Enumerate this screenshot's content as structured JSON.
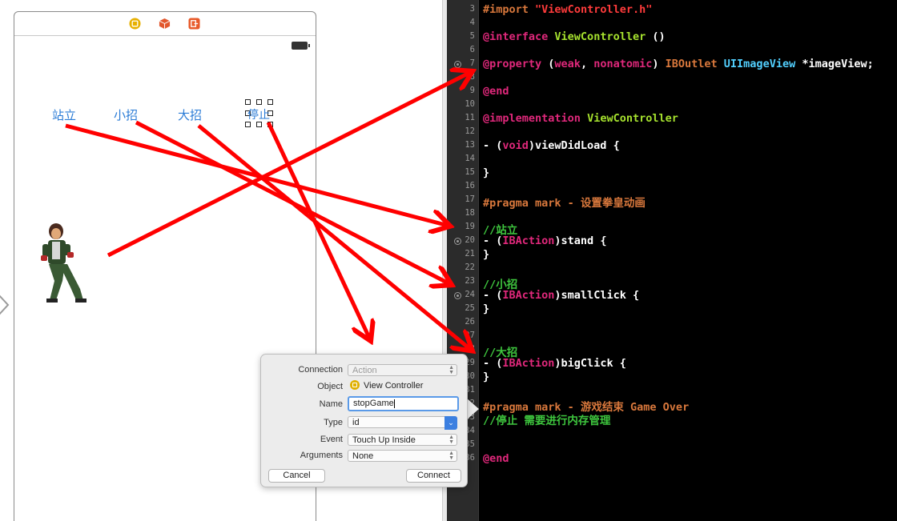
{
  "storyboard": {
    "buttons": [
      "站立",
      "小招",
      "大招",
      "停止"
    ],
    "toolbar_icons": [
      "view-controller-icon",
      "first-responder-icon",
      "exit-icon"
    ],
    "colors": {
      "button_text": "#2a7bd6",
      "arrow": "#ff0000"
    }
  },
  "code": {
    "lines": [
      {
        "n": "3",
        "t": "#import \"ViewController.h\""
      },
      {
        "n": "4",
        "t": ""
      },
      {
        "n": "5",
        "t": "@interface ViewController ()"
      },
      {
        "n": "6",
        "t": ""
      },
      {
        "n": "7",
        "t": "@property (weak, nonatomic) IBOutlet UIImageView *imageView;",
        "connected": true
      },
      {
        "n": "8",
        "t": ""
      },
      {
        "n": "9",
        "t": "@end"
      },
      {
        "n": "10",
        "t": ""
      },
      {
        "n": "11",
        "t": "@implementation ViewController"
      },
      {
        "n": "12",
        "t": ""
      },
      {
        "n": "13",
        "t": "- (void)viewDidLoad {"
      },
      {
        "n": "14",
        "t": ""
      },
      {
        "n": "15",
        "t": "}"
      },
      {
        "n": "16",
        "t": ""
      },
      {
        "n": "17",
        "t": "#pragma mark - 设置拳皇动画"
      },
      {
        "n": "18",
        "t": ""
      },
      {
        "n": "19",
        "t": "//站立"
      },
      {
        "n": "20",
        "t": "- (IBAction)stand {",
        "connected": true
      },
      {
        "n": "21",
        "t": "}"
      },
      {
        "n": "22",
        "t": ""
      },
      {
        "n": "23",
        "t": "//小招"
      },
      {
        "n": "24",
        "t": "- (IBAction)smallClick {",
        "connected": true
      },
      {
        "n": "25",
        "t": "}"
      },
      {
        "n": "26",
        "t": ""
      },
      {
        "n": "27",
        "t": ""
      },
      {
        "n": "28",
        "t": "//大招"
      },
      {
        "n": "29",
        "t": "- (IBAction)bigClick {",
        "connected": true
      },
      {
        "n": "30",
        "t": "}"
      },
      {
        "n": "31",
        "t": ""
      },
      {
        "n": "32",
        "t": "#pragma mark - 游戏结束 Game Over"
      },
      {
        "n": "33",
        "t": "//停止 需要进行内存管理"
      },
      {
        "n": "34",
        "t": ""
      },
      {
        "n": "35",
        "t": ""
      },
      {
        "n": "36",
        "t": "@end"
      }
    ]
  },
  "popover": {
    "labels": {
      "connection": "Connection",
      "object": "Object",
      "name": "Name",
      "type": "Type",
      "event": "Event",
      "arguments": "Arguments"
    },
    "connection_value": "Action",
    "object_value": "View Controller",
    "name_value": "stopGame",
    "type_value": "id",
    "event_value": "Touch Up Inside",
    "arguments_value": "None",
    "cancel_label": "Cancel",
    "connect_label": "Connect"
  }
}
